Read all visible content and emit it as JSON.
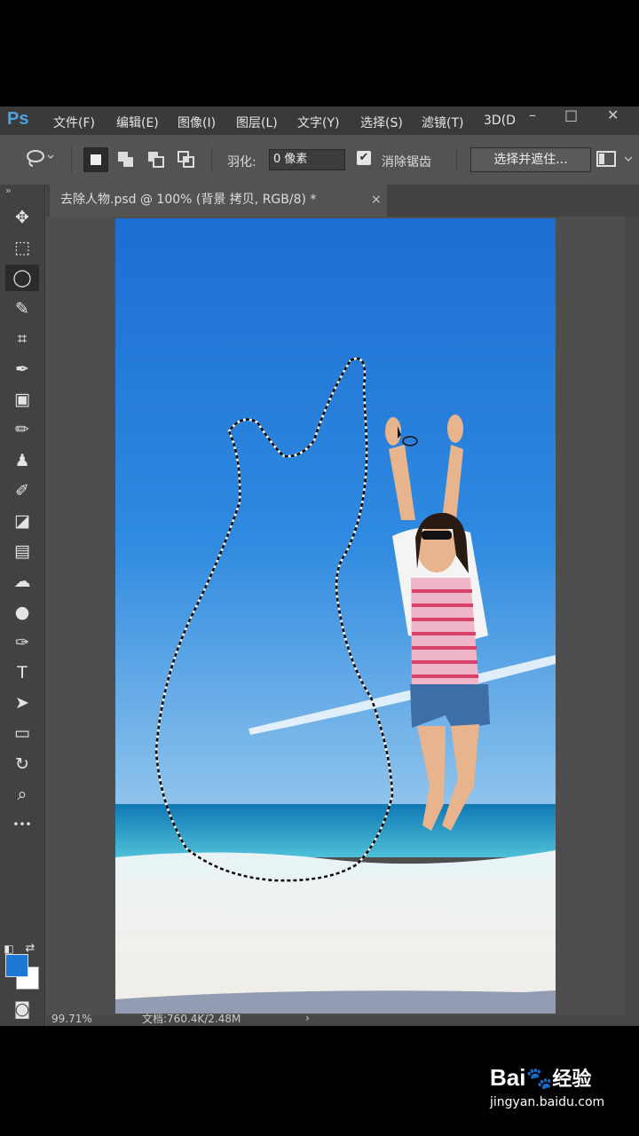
{
  "app": {
    "logo": "Ps"
  },
  "menu": [
    "文件(F)",
    "编辑(E)",
    "图像(I)",
    "图层(L)",
    "文字(Y)",
    "选择(S)",
    "滤镜(T)",
    "3D(D"
  ],
  "window_controls": [
    "–",
    "□",
    "✕"
  ],
  "options": {
    "feather_label": "羽化:",
    "feather_value": "0 像素",
    "antialias_label": "消除锯齿",
    "antialias_checked": true,
    "select_mask_button": "选择并遮住..."
  },
  "document_tab": {
    "title": "去除人物.psd @ 100% (背景 拷贝, RGB/8) *",
    "close": "×"
  },
  "tools": [
    {
      "name": "move-tool",
      "icon": "move-icon",
      "glyph": "✥"
    },
    {
      "name": "marquee-tool",
      "icon": "rect-marquee-icon",
      "glyph": "⬚"
    },
    {
      "name": "lasso-tool",
      "icon": "lasso-icon",
      "glyph": "◯",
      "active": true
    },
    {
      "name": "quick-select-tool",
      "icon": "quick-select-icon",
      "glyph": "✎"
    },
    {
      "name": "crop-tool",
      "icon": "crop-icon",
      "glyph": "⌗"
    },
    {
      "name": "eyedropper-tool",
      "icon": "eyedropper-icon",
      "glyph": "✒"
    },
    {
      "name": "healing-tool",
      "icon": "healing-icon",
      "glyph": "▣"
    },
    {
      "name": "brush-tool",
      "icon": "brush-icon",
      "glyph": "✏"
    },
    {
      "name": "stamp-tool",
      "icon": "stamp-icon",
      "glyph": "♟"
    },
    {
      "name": "history-brush-tool",
      "icon": "history-brush-icon",
      "glyph": "✐"
    },
    {
      "name": "eraser-tool",
      "icon": "eraser-icon",
      "glyph": "◪"
    },
    {
      "name": "gradient-tool",
      "icon": "gradient-icon",
      "glyph": "▤"
    },
    {
      "name": "blur-tool",
      "icon": "blur-icon",
      "glyph": "☁"
    },
    {
      "name": "dodge-tool",
      "icon": "dodge-icon",
      "glyph": "●"
    },
    {
      "name": "pen-tool",
      "icon": "pen-icon",
      "glyph": "✑"
    },
    {
      "name": "type-tool",
      "icon": "type-icon",
      "glyph": "T"
    },
    {
      "name": "path-select-tool",
      "icon": "arrow-icon",
      "glyph": "➤"
    },
    {
      "name": "shape-tool",
      "icon": "rectangle-icon",
      "glyph": "▭"
    },
    {
      "name": "3d-tool",
      "icon": "rotate-3d-icon",
      "glyph": "↻"
    },
    {
      "name": "zoom-tool",
      "icon": "zoom-icon",
      "glyph": "⌕"
    },
    {
      "name": "more-tools",
      "icon": "more-icon",
      "glyph": "•••"
    }
  ],
  "colors": {
    "foreground": "#1f77d4",
    "background": "#ffffff"
  },
  "status": {
    "zoom": "99.71%",
    "doc_info": "文档:760.4K/2.48M"
  },
  "watermark": {
    "brand": "Bai",
    "brand_suffix": "经验",
    "url": "jingyan.baidu.com"
  }
}
